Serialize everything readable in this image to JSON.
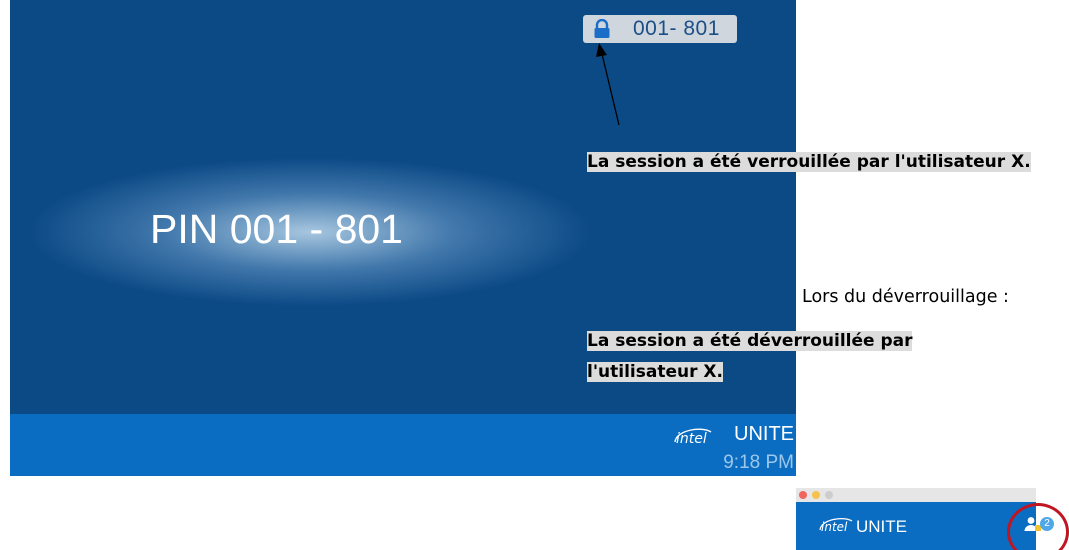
{
  "screen": {
    "lock_pill_pin": "001- 801",
    "pin_display": "PIN 001 - 801",
    "brand_intel": "intel",
    "brand_unite": "UNITE",
    "clock": "9:18 PM"
  },
  "annotations": {
    "locked_message": "La session a été verrouillée par l'utilisateur X.",
    "unlock_label": "Lors du déverrouillage :",
    "unlocked_message": "La session a été déverrouillée par l'utilisateur X."
  },
  "mini_app": {
    "brand_intel": "intel",
    "brand_unite": "UNITE",
    "participants_badge": "2"
  },
  "icons": [
    "lock-icon",
    "intel-logo-icon",
    "users-icon",
    "window-close-dot",
    "window-minimize-dot",
    "window-zoom-dot"
  ],
  "colors": {
    "screen_bg": "#0c4a86",
    "footer_bg": "#0a6dc2",
    "lock_pill_bg": "#cfd6de",
    "highlight_circle": "#c01622",
    "text_highlight": "#dcdcdc"
  }
}
